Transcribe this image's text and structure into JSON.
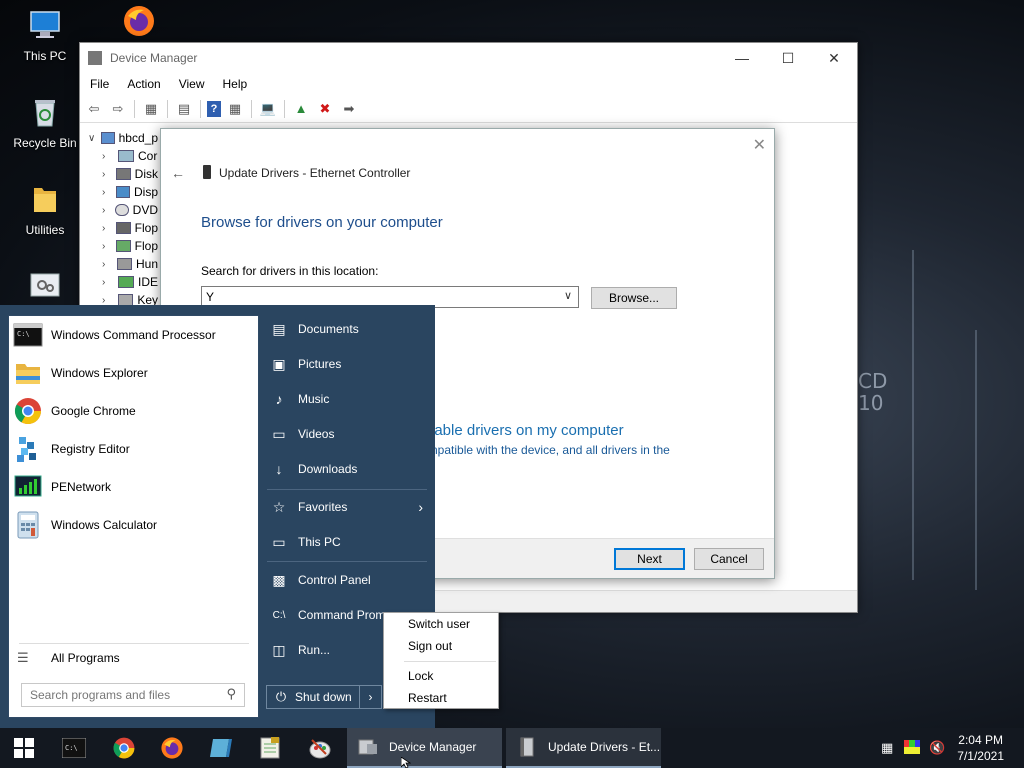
{
  "desktop": {
    "icons": [
      {
        "label": "This PC",
        "icon": "computer-icon"
      },
      {
        "label": "",
        "icon": "firefox-icon"
      },
      {
        "label": "Recycle Bin",
        "icon": "recycle-bin-icon"
      },
      {
        "label": "Utilities",
        "icon": "folder-icon"
      },
      {
        "label": "",
        "icon": "settings-icon"
      }
    ],
    "wallpaper_text": [
      "CD",
      "10"
    ]
  },
  "device_manager": {
    "title": "Device Manager",
    "menu": [
      "File",
      "Action",
      "View",
      "Help"
    ],
    "tree_root": "hbcd_p",
    "tree_items": [
      "Cor",
      "Disk",
      "Disp",
      "DVD",
      "Flop",
      "Flop",
      "Hun",
      "IDE",
      "Key"
    ]
  },
  "dialog": {
    "title": "Update Drivers - Ethernet Controller",
    "heading": "Browse for drivers on your computer",
    "search_label": "Search for drivers in this location:",
    "path_value": "Y",
    "browse_label": "Browse...",
    "pick_link": "lable drivers on my computer",
    "pick_desc": "npatible with the device, and all drivers in the",
    "next_label": "Next",
    "cancel_label": "Cancel"
  },
  "start_menu": {
    "programs": [
      {
        "label": "Windows Command Processor",
        "icon": "cmd-icon"
      },
      {
        "label": "Windows Explorer",
        "icon": "explorer-icon"
      },
      {
        "label": "Google Chrome",
        "icon": "chrome-icon"
      },
      {
        "label": "Registry Editor",
        "icon": "regedit-icon"
      },
      {
        "label": "PENetwork",
        "icon": "network-icon"
      },
      {
        "label": "Windows Calculator",
        "icon": "calculator-icon"
      }
    ],
    "all_programs": "All Programs",
    "search_placeholder": "Search programs and files",
    "right_items": [
      {
        "label": "Documents",
        "icon": "documents-icon"
      },
      {
        "label": "Pictures",
        "icon": "pictures-icon"
      },
      {
        "label": "Music",
        "icon": "music-icon"
      },
      {
        "label": "Videos",
        "icon": "videos-icon"
      },
      {
        "label": "Downloads",
        "icon": "downloads-icon"
      },
      {
        "label": "Favorites",
        "icon": "star-icon"
      },
      {
        "label": "This PC",
        "icon": "computer-icon"
      },
      {
        "label": "Control Panel",
        "icon": "control-panel-icon"
      },
      {
        "label": "Command Prom",
        "icon": "cmd-icon"
      },
      {
        "label": "Run...",
        "icon": "run-icon"
      }
    ],
    "shutdown_label": "Shut down"
  },
  "power_menu": {
    "items": [
      "Switch user",
      "Sign out",
      "Lock",
      "Restart"
    ]
  },
  "taskbar": {
    "pinned": [
      "start-icon",
      "cmd-icon",
      "chrome-icon",
      "firefox-icon",
      "explorer-icon",
      "notepad-icon",
      "paint-icon"
    ],
    "tasks": [
      {
        "label": "Device Manager"
      },
      {
        "label": "Update Drivers - Et..."
      }
    ],
    "time": "2:04 PM",
    "date": "7/1/2021"
  }
}
